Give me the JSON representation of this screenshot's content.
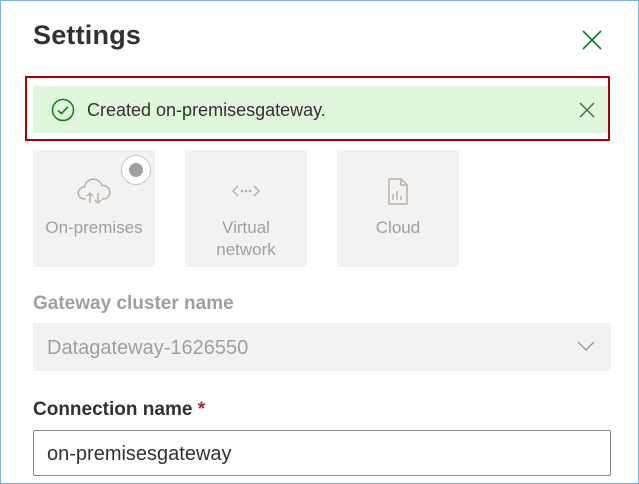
{
  "panel": {
    "title": "Settings",
    "close_icon": "close-icon"
  },
  "notification": {
    "text": "Created on-premisesgateway.",
    "status": "success",
    "icon": "check-circle-icon",
    "dismiss_icon": "close-icon",
    "background": "#dff6dd",
    "highlight_color": "#a80000"
  },
  "gateway_types": [
    {
      "label": "On-premises",
      "icon": "cloud-upload-icon",
      "selected": true
    },
    {
      "label": "Virtual",
      "label2": "network",
      "icon": "virtual-network-icon",
      "selected": false
    },
    {
      "label": "Cloud",
      "icon": "cloud-file-icon",
      "selected": false
    }
  ],
  "gateway_cluster": {
    "label": "Gateway cluster name",
    "value": "Datagateway-1626550",
    "disabled": true
  },
  "connection_name": {
    "label": "Connection name",
    "required_marker": "*",
    "value": "on-premisesgateway"
  }
}
